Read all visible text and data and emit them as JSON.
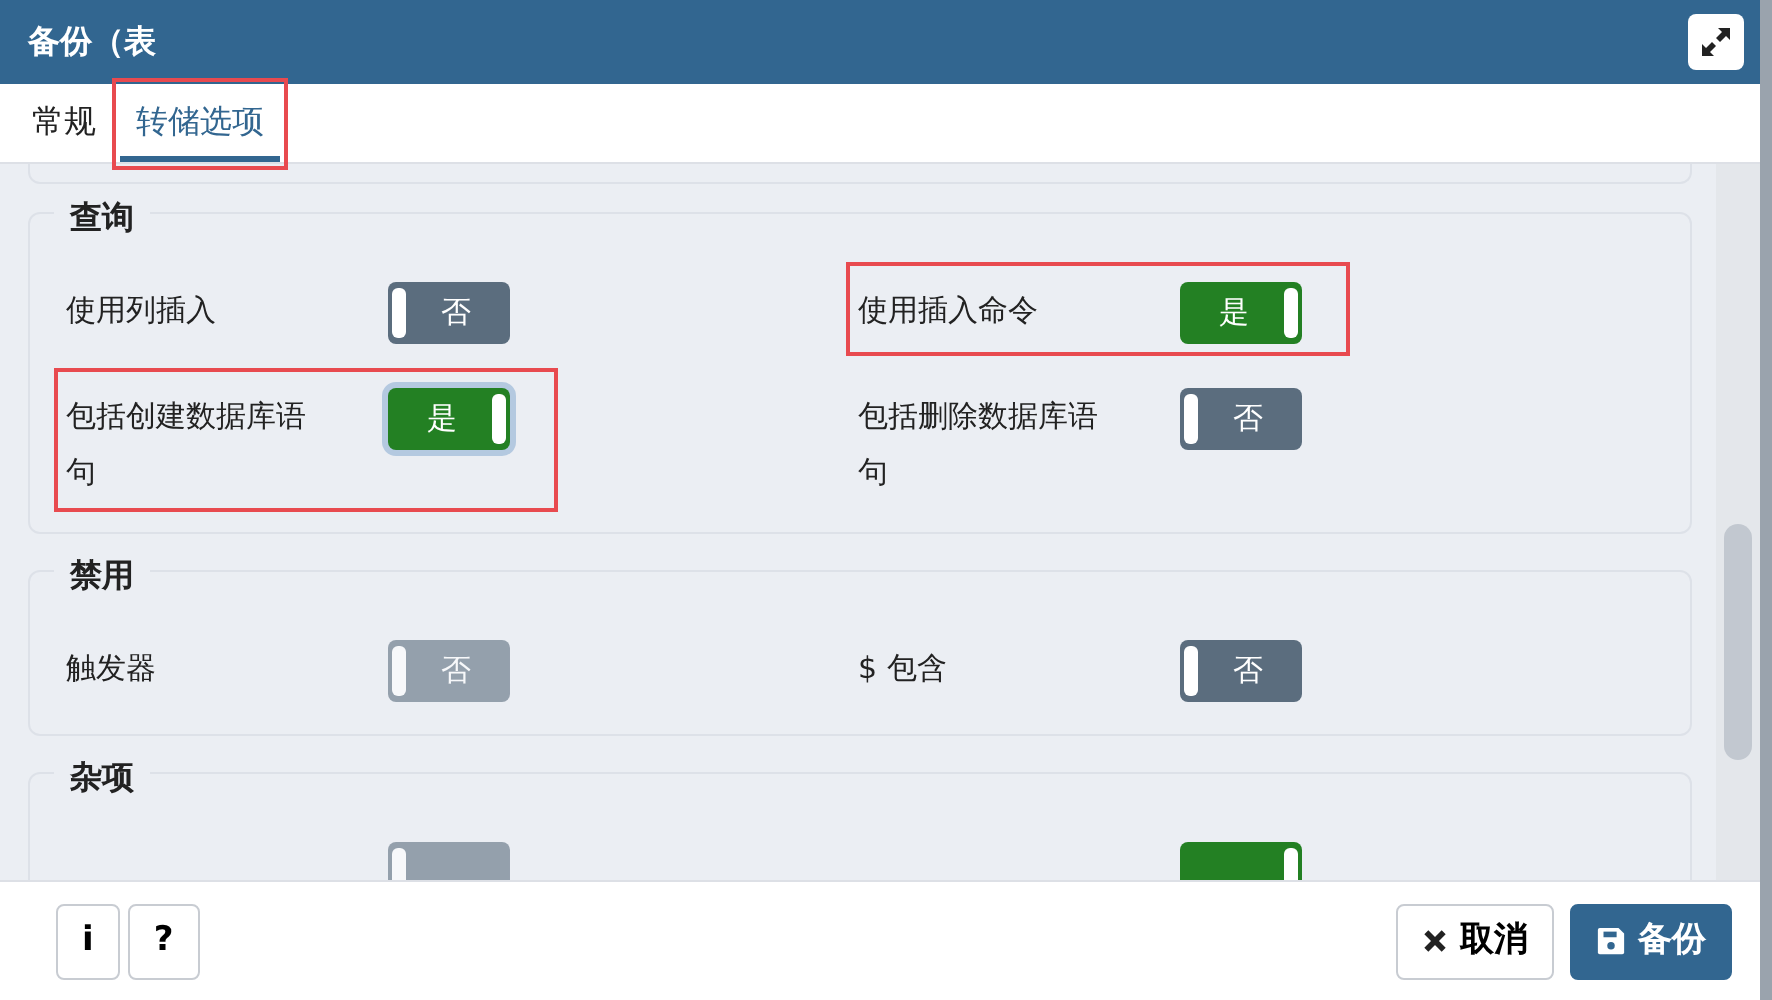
{
  "window": {
    "title": "备份（表"
  },
  "tabs": [
    {
      "label": "常规",
      "selected": false,
      "highlighted": false
    },
    {
      "label": "转储选项",
      "selected": true,
      "highlighted": true
    }
  ],
  "sections": [
    {
      "title": "查询",
      "items": [
        {
          "label": "使用列插入",
          "text": "否",
          "on": false,
          "disabled": false,
          "focused": false,
          "highlighted": false
        },
        {
          "label": "使用插入命令",
          "text": "是",
          "on": true,
          "disabled": false,
          "focused": false,
          "highlighted": true
        },
        {
          "label": "包括创建数据库语句",
          "text": "是",
          "on": true,
          "disabled": false,
          "focused": true,
          "highlighted": true
        },
        {
          "label": "包括删除数据库语句",
          "text": "否",
          "on": false,
          "disabled": false,
          "focused": false,
          "highlighted": false
        }
      ]
    },
    {
      "title": "禁用",
      "items": [
        {
          "label": "触发器",
          "text": "否",
          "on": false,
          "disabled": true,
          "focused": false,
          "highlighted": false
        },
        {
          "label": "$ 包含",
          "text": "否",
          "on": false,
          "disabled": false,
          "focused": false,
          "highlighted": false
        }
      ]
    },
    {
      "title": "杂项",
      "items": [
        {
          "on": false,
          "disabled": true,
          "focused": false,
          "highlighted": false
        },
        {
          "on": true,
          "disabled": false,
          "focused": false,
          "highlighted": false
        }
      ]
    }
  ],
  "footer": {
    "info_button": "i",
    "help_button": "?",
    "cancel_button": "取消",
    "save_button": "备份"
  }
}
